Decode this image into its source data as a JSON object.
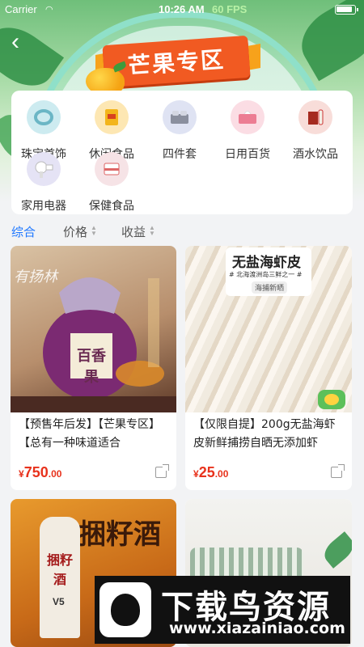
{
  "status_bar": {
    "carrier": "Carrier",
    "time": "10:26 AM",
    "fps": "60 FPS"
  },
  "header": {
    "title": "芒果专区"
  },
  "categories": [
    {
      "label": "珠宝首饰",
      "icon": "bracelet-icon",
      "color": "#cdebf0"
    },
    {
      "label": "休闲食品",
      "icon": "snack-icon",
      "color": "#fde7b3"
    },
    {
      "label": "四件套",
      "icon": "bedding-icon",
      "color": "#dfe3f3"
    },
    {
      "label": "日用百货",
      "icon": "tissue-icon",
      "color": "#fbdde4"
    },
    {
      "label": "酒水饮品",
      "icon": "liquor-icon",
      "color": "#f8ddd9"
    },
    {
      "label": "家用电器",
      "icon": "hairdryer-icon",
      "color": "#e5e3f5"
    },
    {
      "label": "保健食品",
      "icon": "supplement-icon",
      "color": "#f6e3e6"
    }
  ],
  "sort_tabs": [
    {
      "label": "综合",
      "active": true
    },
    {
      "label": "价格",
      "active": false
    },
    {
      "label": "收益",
      "active": false
    }
  ],
  "products": [
    {
      "title": "【预售年后发】【芒果专区】【总有一种味道适合",
      "currency": "¥",
      "price_int": "750",
      "price_dec": ".00",
      "image_text": "有扬林",
      "label_text": "百香果"
    },
    {
      "title": "【仅限自提】200g无盐海虾皮新鲜捕捞自晒无添加虾",
      "currency": "¥",
      "price_int": "25",
      "price_dec": ".00",
      "image_text": "无盐海虾皮",
      "image_subtext": "# 北海渡洲岛三鲜之一 #",
      "image_tag": "海捕新晒"
    },
    {
      "image_text": "捆籽酒",
      "bottle_text": "捆籽酒",
      "bottle_sub": "V5"
    },
    {
      "image_text": ""
    }
  ],
  "watermark": {
    "text": "下载鸟资源",
    "url": "www.xiazainiao.com"
  },
  "colors": {
    "accent": "#1e77ff",
    "price": "#e8321c",
    "banner": "#f15a22"
  }
}
